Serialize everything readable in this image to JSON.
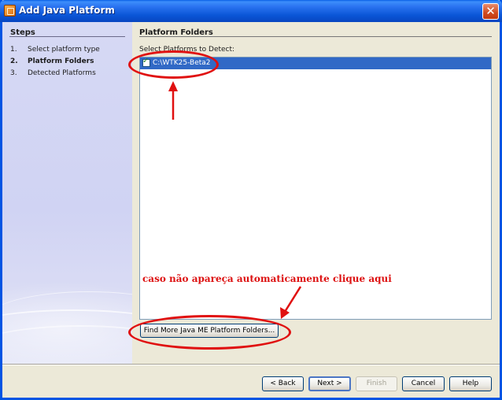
{
  "window": {
    "title": "Add Java Platform",
    "close_glyph": "✕"
  },
  "steps": {
    "title": "Steps",
    "items": [
      {
        "num": "1.",
        "label": "Select platform type",
        "bold": false
      },
      {
        "num": "2.",
        "label": "Platform Folders",
        "bold": true
      },
      {
        "num": "3.",
        "label": "Detected Platforms",
        "bold": false
      }
    ]
  },
  "panel": {
    "title": "Platform Folders",
    "detect_label": "Select Platforms to Detect:",
    "list_items": [
      {
        "label": "C:\\WTK25-Beta2",
        "checked": true
      }
    ],
    "find_button": "Find More Java ME Platform Folders..."
  },
  "annotation": {
    "text": "caso não apareça automaticamente clique aqui",
    "color": "#dd1111"
  },
  "buttons": {
    "back": "< Back",
    "next": "Next >",
    "finish": "Finish",
    "cancel": "Cancel",
    "help": "Help"
  },
  "colors": {
    "titlebar": "#0a55d6",
    "selection": "#3169c6",
    "annotation": "#e01010",
    "steps_bg": "#d0d3f3"
  }
}
